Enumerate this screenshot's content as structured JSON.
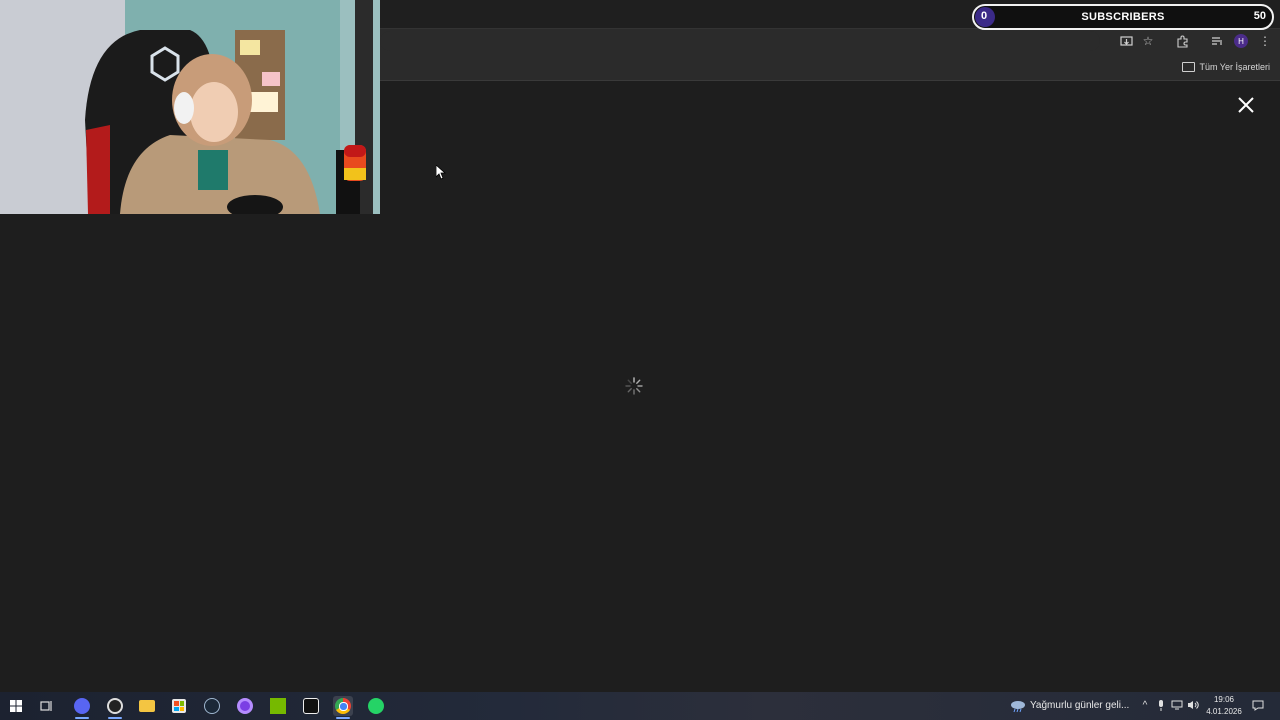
{
  "overlay": {
    "subscribers_label": "SUBSCRIBERS",
    "current_count": "0",
    "goal_count": "50",
    "progress_fraction": 0.0,
    "accent_color": "#5b3cc4"
  },
  "browser": {
    "profile_initial": "H",
    "bookmarks_all_label": "Tüm Yer İşaretleri",
    "toolbar_icons": [
      "install-app-icon",
      "star-icon",
      "extensions-icon",
      "media-control-icon",
      "profile-avatar-icon",
      "more-menu-icon"
    ]
  },
  "main": {
    "state": "loading",
    "close_icon": "close-icon"
  },
  "taskbar": {
    "apps": [
      "start-icon",
      "task-view-icon",
      "discord-icon",
      "obs-icon",
      "file-explorer-icon",
      "store-icon",
      "steam-icon",
      "app-circle-icon",
      "nvidia-icon",
      "capcut-icon",
      "chrome-icon",
      "whatsapp-icon"
    ],
    "weather_text": "Yağmurlu günler geli...",
    "time": "19:06",
    "date": "4.01.2026"
  }
}
